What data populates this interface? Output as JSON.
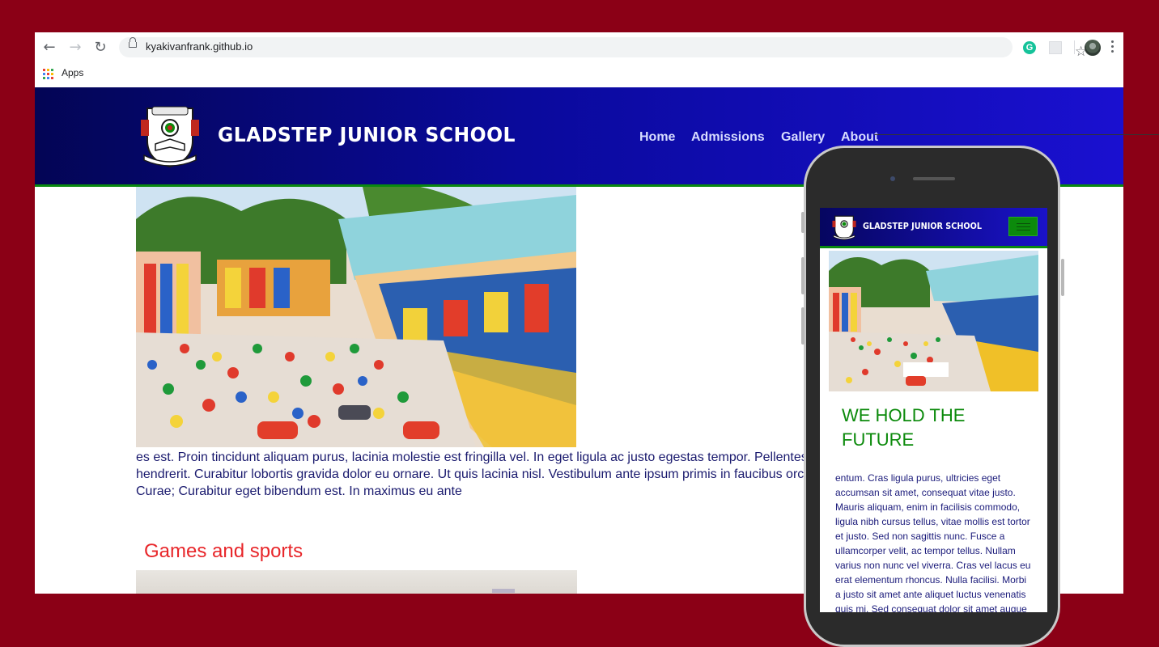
{
  "browser": {
    "url": "kyakivanfrank.github.io",
    "bookmarks": [
      {
        "label": "Apps"
      }
    ]
  },
  "site": {
    "title": "GLADSTEP JUNIOR SCHOOL",
    "nav": [
      "Home",
      "Admissions",
      "Gallery",
      "About"
    ],
    "body_text": "es est. Proin tincidunt aliquam purus, lacinia molestie est fringilla vel. In eget ligula ac justo egestas tempor. Pellentes\nhendrerit. Curabitur lobortis gravida dolor eu ornare. Ut quis lacinia nisl. Vestibulum ante ipsum primis in faucibus orc\nCurae; Curabitur eget bibendum est. In maximus eu ante",
    "section_heading": "Games and sports"
  },
  "mobile": {
    "title": "GLADSTEP JUNIOR SCHOOL",
    "heading": "WE HOLD THE FUTURE",
    "text": "entum. Cras ligula purus, ultricies eget\naccumsan sit amet, consequat vitae justo.\nMauris aliquam, enim in facilisis commodo,\nligula nibh cursus tellus, vitae mollis est tortor\net justo. Sed non sagittis nunc. Fusce a\nullamcorper velit, ac tempor tellus. Nullam\nvarius non nunc vel viverra. Cras vel lacus eu\nerat elementum rhoncus. Nulla facilisi. Morbi\na justo sit amet ante aliquet luctus venenatis\nquis mi. Sed consequat dolor sit amet augue"
  },
  "colors": {
    "background": "#8b0016",
    "header_blue": "#0a0a9c",
    "accent_green": "#0b8a0b",
    "section_red": "#e8262a",
    "text_navy": "#1a1a6e"
  }
}
